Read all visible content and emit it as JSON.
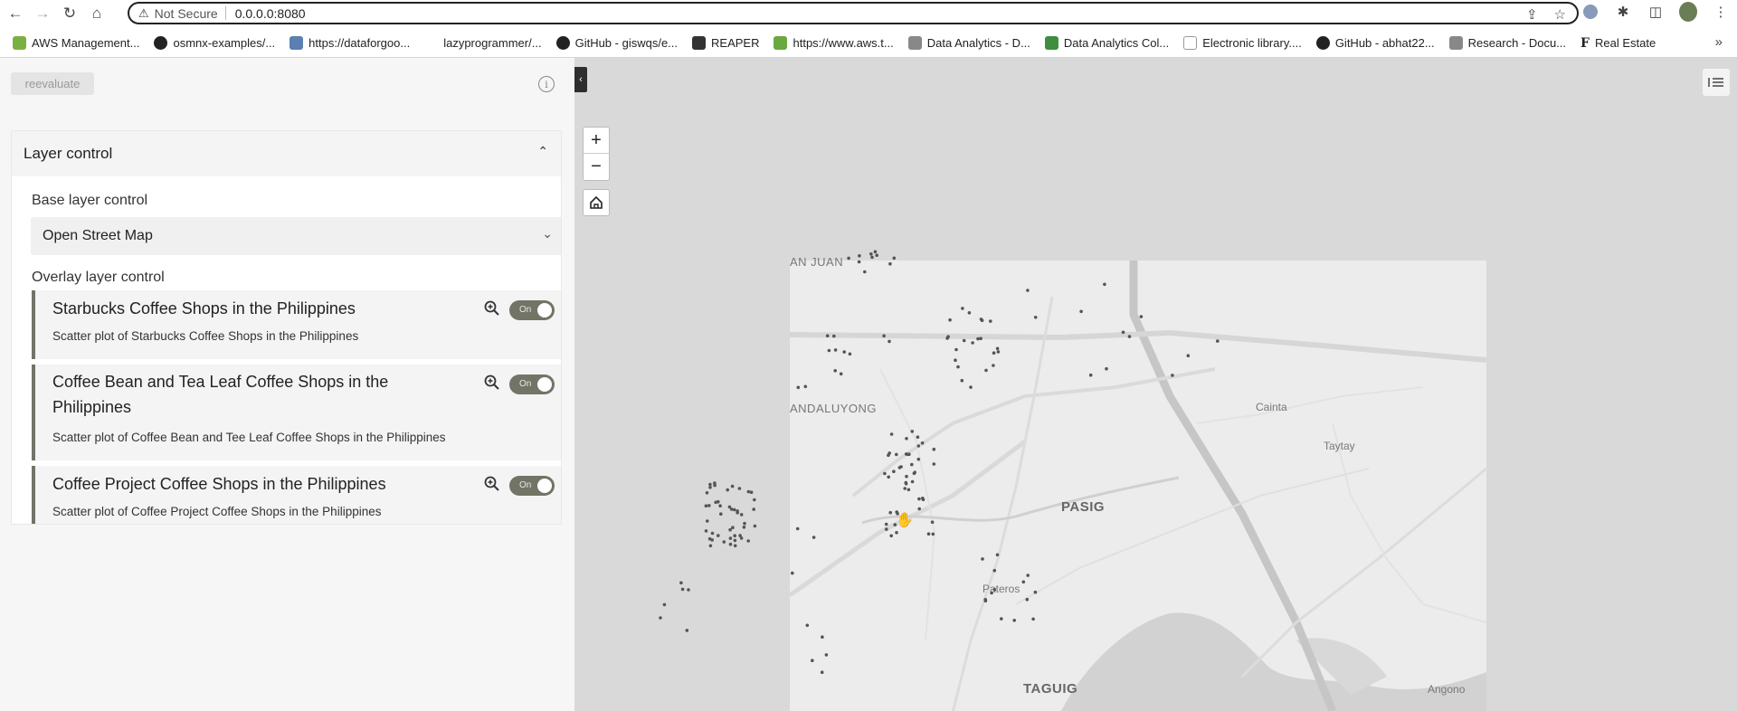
{
  "browser": {
    "security_label": "Not Secure",
    "url": "0.0.0.0:8080",
    "bookmarks": [
      {
        "label": "AWS Management...",
        "color": "#7ab040"
      },
      {
        "label": "osmnx-examples/...",
        "color": "#222222"
      },
      {
        "label": "https://dataforgoo...",
        "color": "#5a7fb0"
      },
      {
        "label": "lazyprogrammer/...",
        "color": "#ffffff"
      },
      {
        "label": "GitHub - giswqs/e...",
        "color": "#222222"
      },
      {
        "label": "REAPER",
        "color": "#333333"
      },
      {
        "label": "https://www.aws.t...",
        "color": "#6aa840"
      },
      {
        "label": "Data Analytics - D...",
        "color": "#888888"
      },
      {
        "label": "Data Analytics Col...",
        "color": "#3e8e3e"
      },
      {
        "label": "Electronic library....",
        "color": "#ffffff"
      },
      {
        "label": "GitHub - abhat22...",
        "color": "#222222"
      },
      {
        "label": "Research - Docu...",
        "color": "#888888"
      },
      {
        "label": "Real Estate",
        "color": "#ffffff"
      }
    ]
  },
  "panel": {
    "reevaluate_label": "reevaluate",
    "card_title": "Layer control",
    "base_layer_label": "Base layer control",
    "base_layer_value": "Open Street Map",
    "overlay_label": "Overlay layer control",
    "layers": [
      {
        "title": "Starbucks Coffee Shops in the Philippines",
        "description": "Scatter plot of Starbucks Coffee Shops in the Philippines",
        "toggle": "On"
      },
      {
        "title": "Coffee Bean and Tea Leaf Coffee Shops in the Philippines",
        "description": "Scatter plot of Coffee Bean and Tee Leaf Coffee Shops in the Philippines",
        "toggle": "On"
      },
      {
        "title": "Coffee Project Coffee Shops in the Philippines",
        "description": "Scatter plot of Coffee Project Coffee Shops in the Philippines",
        "toggle": "On"
      }
    ]
  },
  "map": {
    "places": [
      {
        "label": "AN JUAN"
      },
      {
        "label": "ANDALUYONG"
      },
      {
        "label": "Cainta"
      },
      {
        "label": "Taytay"
      },
      {
        "label": "PASIG"
      },
      {
        "label": "Pateros"
      },
      {
        "label": "TAGUIG"
      },
      {
        "label": "Angono"
      }
    ],
    "colors": {
      "road_major": "#d3d3d3",
      "road_minor": "#e0e0e0",
      "water": "#d2d2d2",
      "point": "#555555"
    }
  }
}
